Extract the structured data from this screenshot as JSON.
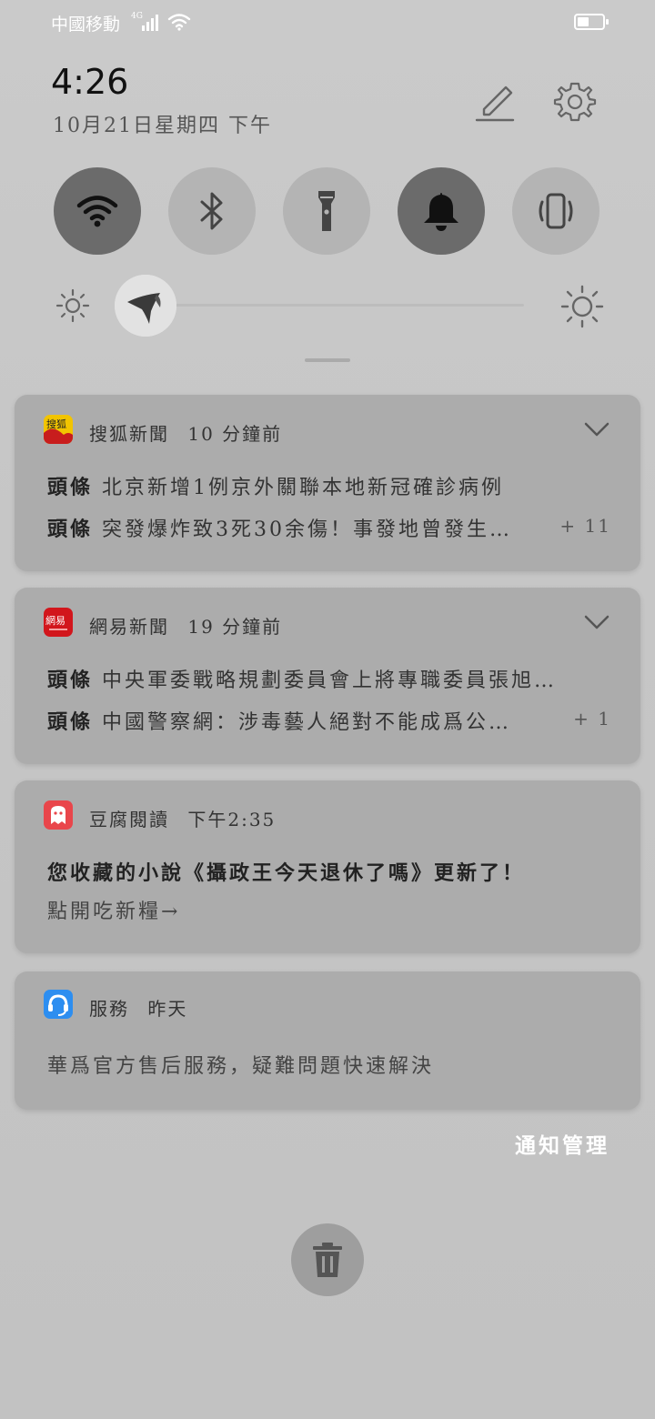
{
  "status_bar": {
    "carrier": "中國移動",
    "network": "4G",
    "battery_level": 0.45
  },
  "header": {
    "time": "4:26",
    "date": "10月21日星期四 下午"
  },
  "quick_toggles": [
    {
      "name": "wifi",
      "state": "on"
    },
    {
      "name": "bluetooth",
      "state": "off"
    },
    {
      "name": "flashlight",
      "state": "off"
    },
    {
      "name": "sound",
      "state": "on"
    },
    {
      "name": "vibrate",
      "state": "off"
    }
  ],
  "brightness": {
    "level": 0.0
  },
  "notifications": [
    {
      "app": "搜狐新聞",
      "time": "10 分鐘前",
      "rows": [
        {
          "label": "頭條",
          "text": "北京新增1例京外關聯本地新冠確診病例"
        },
        {
          "label": "頭條",
          "text": "突發爆炸致3死30余傷！事發地曾發生…",
          "more": "+ 11"
        }
      ]
    },
    {
      "app": "網易新聞",
      "time": "19 分鐘前",
      "rows": [
        {
          "label": "頭條",
          "text": "中央軍委戰略規劃委員會上將專職委員張旭…"
        },
        {
          "label": "頭條",
          "text": "中國警察網：涉毒藝人絕對不能成爲公…",
          "more": "+ 1"
        }
      ]
    },
    {
      "app": "豆腐閱讀",
      "time": "下午2:35",
      "title": "您收藏的小說《攝政王今天退休了嗎》更新了！",
      "body": "點開吃新糧→"
    },
    {
      "app": "服務",
      "time": "昨天",
      "body": "華爲官方售后服務，疑難問題快速解決"
    }
  ],
  "footer": {
    "manage_label": "通知管理"
  }
}
